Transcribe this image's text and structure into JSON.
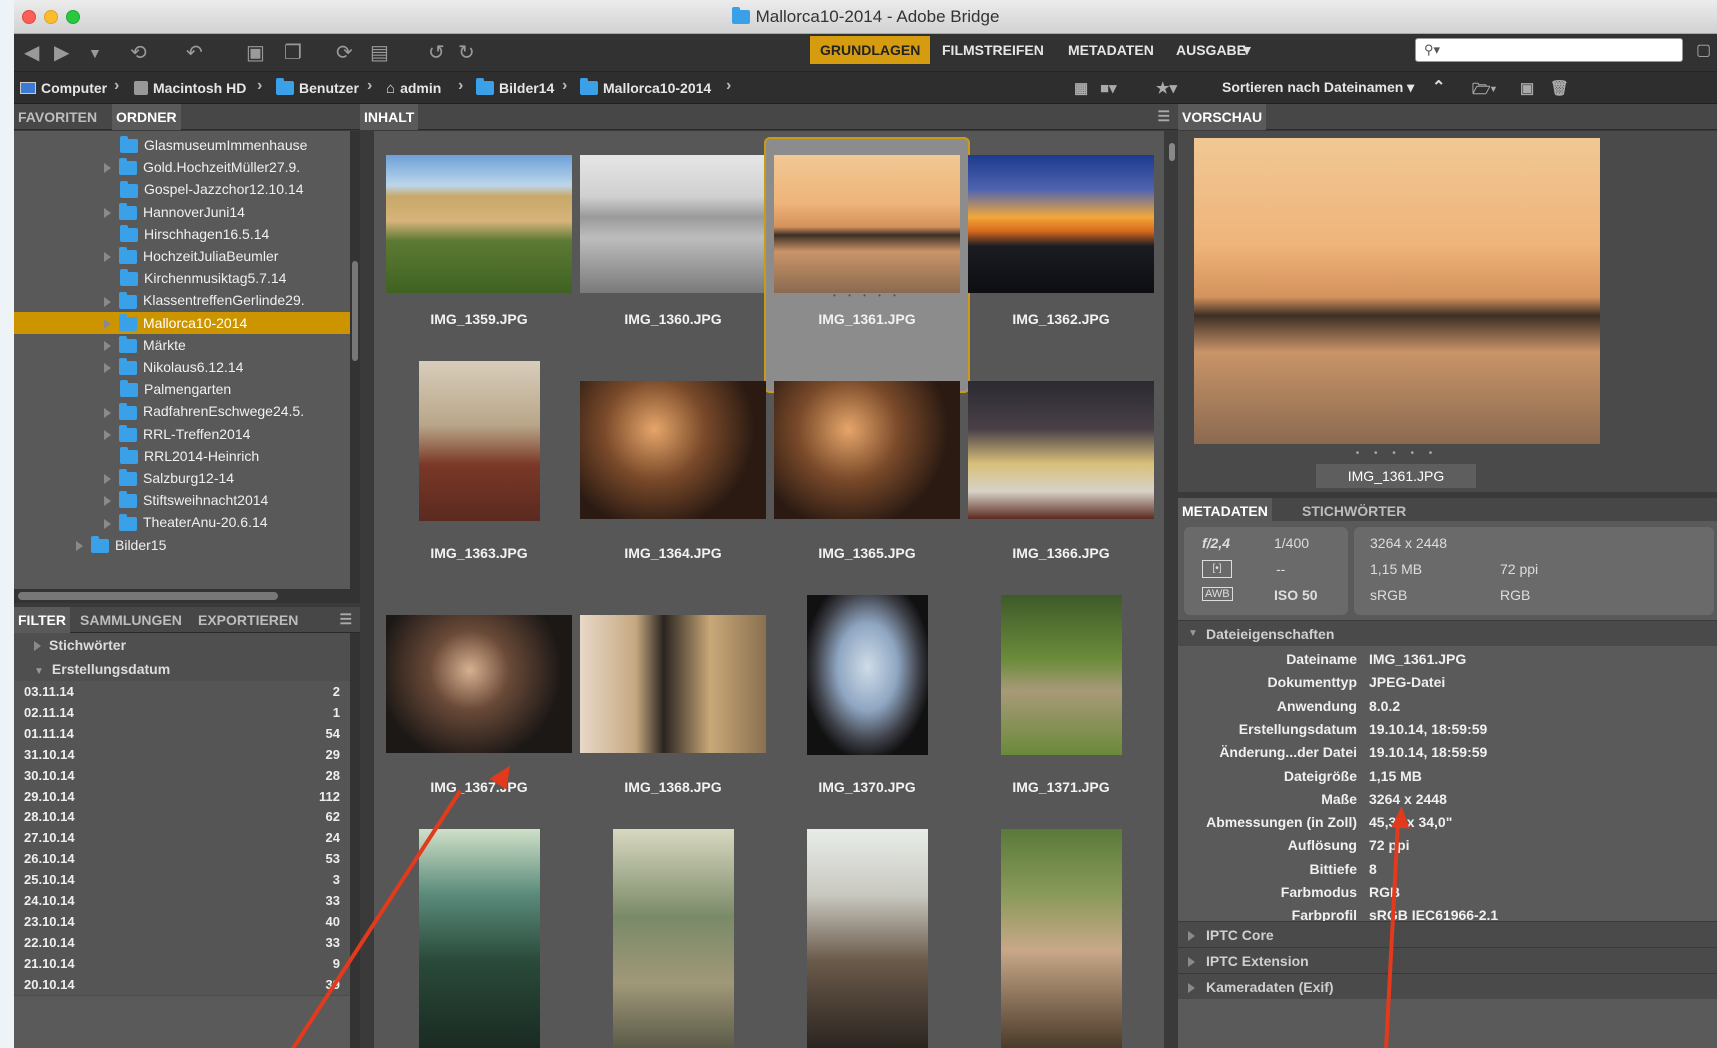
{
  "window": {
    "title": "Mallorca10-2014 - Adobe Bridge"
  },
  "workspaces": [
    "GRUNDLAGEN",
    "FILMSTREIFEN",
    "METADATEN",
    "AUSGABE"
  ],
  "search": {
    "placeholder": ""
  },
  "path": [
    "Computer",
    "Macintosh HD",
    "Benutzer",
    "admin",
    "Bilder14",
    "Mallorca10-2014"
  ],
  "sort_label": "Sortieren nach Dateinamen",
  "left_tabs": {
    "favorites": "FAVORITEN",
    "folders": "ORDNER"
  },
  "folders": [
    {
      "name": "GlasmuseumImmenhause",
      "expandable": false
    },
    {
      "name": "Gold.HochzeitMüller27.9.",
      "expandable": true
    },
    {
      "name": "Gospel-Jazzchor12.10.14",
      "expandable": false
    },
    {
      "name": "HannoverJuni14",
      "expandable": true
    },
    {
      "name": "Hirschhagen16.5.14",
      "expandable": false
    },
    {
      "name": "HochzeitJuliaBeumler",
      "expandable": true
    },
    {
      "name": "Kirchenmusiktag5.7.14",
      "expandable": false
    },
    {
      "name": "KlassentreffenGerlinde29.",
      "expandable": true
    },
    {
      "name": "Mallorca10-2014",
      "expandable": true,
      "selected": true
    },
    {
      "name": "Märkte",
      "expandable": true
    },
    {
      "name": "Nikolaus6.12.14",
      "expandable": true
    },
    {
      "name": "Palmengarten",
      "expandable": false
    },
    {
      "name": "RadfahrenEschwege24.5.",
      "expandable": true
    },
    {
      "name": "RRL-Treffen2014",
      "expandable": true
    },
    {
      "name": "RRL2014-Heinrich",
      "expandable": false
    },
    {
      "name": "Salzburg12-14",
      "expandable": true
    },
    {
      "name": "Stiftsweihnacht2014",
      "expandable": true
    },
    {
      "name": "TheaterAnu-20.6.14",
      "expandable": true
    },
    {
      "name": "Bilder15",
      "expandable": true,
      "level": 0
    }
  ],
  "filter_tabs": [
    "FILTER",
    "SAMMLUNGEN",
    "EXPORTIEREN"
  ],
  "filter_sections": {
    "keywords": "Stichwörter",
    "date": "Erstellungsdatum"
  },
  "filter_dates": [
    {
      "date": "03.11.14",
      "count": "2"
    },
    {
      "date": "02.11.14",
      "count": "1"
    },
    {
      "date": "01.11.14",
      "count": "54"
    },
    {
      "date": "31.10.14",
      "count": "29"
    },
    {
      "date": "30.10.14",
      "count": "28"
    },
    {
      "date": "29.10.14",
      "count": "112"
    },
    {
      "date": "28.10.14",
      "count": "62"
    },
    {
      "date": "27.10.14",
      "count": "24"
    },
    {
      "date": "26.10.14",
      "count": "53"
    },
    {
      "date": "25.10.14",
      "count": "3"
    },
    {
      "date": "24.10.14",
      "count": "33"
    },
    {
      "date": "23.10.14",
      "count": "40"
    },
    {
      "date": "22.10.14",
      "count": "33"
    },
    {
      "date": "21.10.14",
      "count": "9"
    },
    {
      "date": "20.10.14",
      "count": "39"
    }
  ],
  "content_tab": "INHALT",
  "thumbnails": [
    {
      "name": "IMG_1359.JPG",
      "scene": "resort"
    },
    {
      "name": "IMG_1360.JPG",
      "scene": "bwbeach"
    },
    {
      "name": "IMG_1361.JPG",
      "scene": "sunset",
      "selected": true
    },
    {
      "name": "IMG_1362.JPG",
      "scene": "dusk"
    },
    {
      "name": "IMG_1363.JPG",
      "scene": "child",
      "portrait": true
    },
    {
      "name": "IMG_1364.JPG",
      "scene": "dinner"
    },
    {
      "name": "IMG_1365.JPG",
      "scene": "dinner"
    },
    {
      "name": "IMG_1366.JPG",
      "scene": "plate"
    },
    {
      "name": "IMG_1367.JPG",
      "scene": "party"
    },
    {
      "name": "IMG_1368.JPG",
      "scene": "party2"
    },
    {
      "name": "IMG_1370.JPG",
      "scene": "plane",
      "portrait": true
    },
    {
      "name": "IMG_1371.JPG",
      "scene": "turtle",
      "portrait": true
    },
    {
      "name": "",
      "scene": "green",
      "portrait": true
    },
    {
      "name": "",
      "scene": "alley",
      "portrait": true
    },
    {
      "name": "",
      "scene": "cafe",
      "portrait": true
    },
    {
      "name": "",
      "scene": "couple",
      "portrait": true
    }
  ],
  "preview": {
    "tab": "VORSCHAU",
    "filename": "IMG_1361.JPG"
  },
  "meta_tabs": [
    "METADATEN",
    "STICHWÖRTER"
  ],
  "camera": {
    "aperture": "f/2,4",
    "shutter": "1/400",
    "metering": "--",
    "wb": "AWB",
    "iso": "ISO 50"
  },
  "file_summary": {
    "dimensions": "3264 x 2448",
    "size": "1,15 MB",
    "resolution": "72 ppi",
    "colorprofile": "sRGB",
    "colormode": "RGB"
  },
  "file_props_title": "Dateieigenschaften",
  "file_props": [
    {
      "k": "Dateiname",
      "v": "IMG_1361.JPG"
    },
    {
      "k": "Dokumenttyp",
      "v": "JPEG-Datei"
    },
    {
      "k": "Anwendung",
      "v": "8.0.2"
    },
    {
      "k": "Erstellungsdatum",
      "v": "19.10.14, 18:59:59"
    },
    {
      "k": "Änderung...der Datei",
      "v": "19.10.14, 18:59:59"
    },
    {
      "k": "Dateigröße",
      "v": "1,15 MB"
    },
    {
      "k": "Maße",
      "v": "3264 x 2448"
    },
    {
      "k": "Abmessungen (in Zoll)",
      "v": "45,3\" x 34,0\""
    },
    {
      "k": "Auflösung",
      "v": "72 ppi"
    },
    {
      "k": "Bittiefe",
      "v": "8"
    },
    {
      "k": "Farbmodus",
      "v": "RGB"
    },
    {
      "k": "Farbprofil",
      "v": "sRGB IEC61966-2.1"
    }
  ],
  "collapsed_sections": [
    "IPTC Core",
    "IPTC Extension",
    "Kameradaten (Exif)"
  ],
  "colors": {
    "accent": "#cc9500",
    "annotation": "#e33a1e"
  }
}
